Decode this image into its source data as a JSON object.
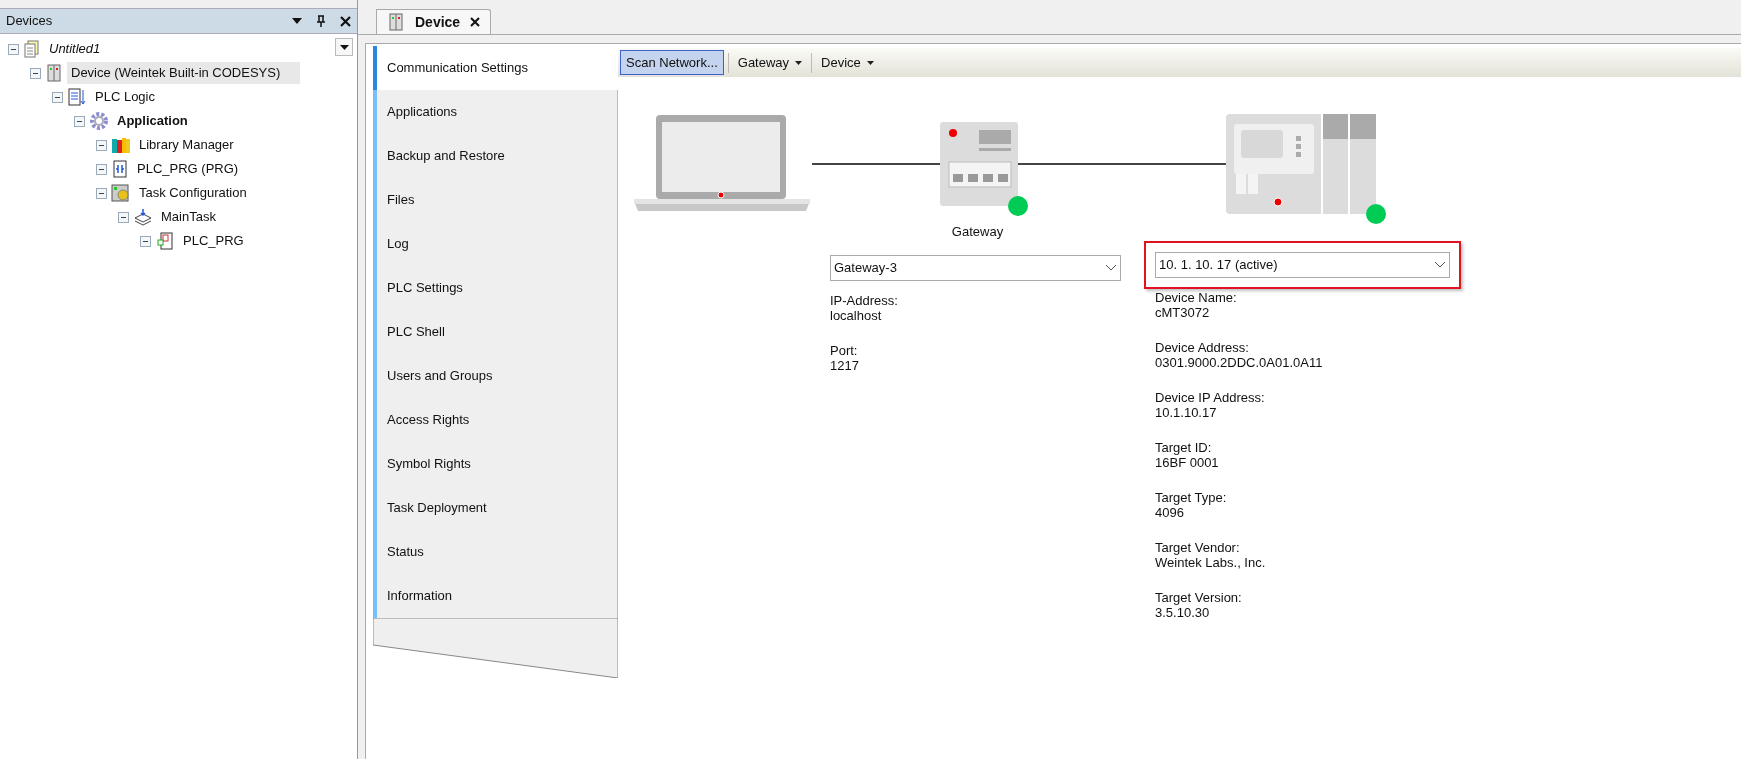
{
  "devices_panel": {
    "title": "Devices",
    "tree": [
      {
        "label": "Untitled1",
        "kind": "project",
        "selected": false,
        "active": false,
        "children": [
          {
            "label": "Device (Weintek Built-in CODESYS)",
            "kind": "device",
            "selected": true,
            "active": false,
            "children": [
              {
                "label": "PLC Logic",
                "kind": "plc-logic",
                "selected": false,
                "active": false,
                "children": [
                  {
                    "label": "Application",
                    "kind": "application",
                    "selected": false,
                    "active": true,
                    "children": [
                      {
                        "label": "Library Manager",
                        "kind": "library",
                        "selected": false,
                        "active": false
                      },
                      {
                        "label": "PLC_PRG (PRG)",
                        "kind": "pou",
                        "selected": false,
                        "active": false
                      },
                      {
                        "label": "Task Configuration",
                        "kind": "task-config",
                        "selected": false,
                        "active": false,
                        "children": [
                          {
                            "label": "MainTask",
                            "kind": "task",
                            "selected": false,
                            "active": false,
                            "children": [
                              {
                                "label": "PLC_PRG",
                                "kind": "program-call",
                                "selected": false,
                                "active": false
                              }
                            ]
                          }
                        ]
                      }
                    ]
                  }
                ]
              }
            ]
          }
        ]
      }
    ]
  },
  "editor_tab": {
    "label": "Device",
    "selected": true
  },
  "side_tabs": [
    {
      "label": "Communication Settings",
      "selected": true
    },
    {
      "label": "Applications",
      "selected": false
    },
    {
      "label": "Backup and Restore",
      "selected": false
    },
    {
      "label": "Files",
      "selected": false
    },
    {
      "label": "Log",
      "selected": false
    },
    {
      "label": "PLC Settings",
      "selected": false
    },
    {
      "label": "PLC Shell",
      "selected": false
    },
    {
      "label": "Users and Groups",
      "selected": false
    },
    {
      "label": "Access Rights",
      "selected": false
    },
    {
      "label": "Symbol Rights",
      "selected": false
    },
    {
      "label": "Task Deployment",
      "selected": false
    },
    {
      "label": "Status",
      "selected": false
    },
    {
      "label": "Information",
      "selected": false
    }
  ],
  "toolbar": [
    {
      "label": "Scan Network...",
      "kind": "button",
      "highlighted": true
    },
    {
      "label": "Gateway",
      "kind": "dropdown",
      "highlighted": false
    },
    {
      "label": "Device",
      "kind": "dropdown",
      "highlighted": false
    }
  ],
  "gateway": {
    "label": "Gateway",
    "online": true,
    "selector": {
      "value": "Gateway-3",
      "highlighted": false
    },
    "details": [
      {
        "label": "IP-Address:",
        "value": "localhost"
      },
      {
        "label": "Port:",
        "value": "1217"
      }
    ]
  },
  "device": {
    "online": true,
    "selector": {
      "value": "10. 1. 10. 17 (active)",
      "highlighted": true
    },
    "details": [
      {
        "label": "Device Name:",
        "value": "cMT3072"
      },
      {
        "label": "Device Address:",
        "value": "0301.9000.2DDC.0A01.0A11"
      },
      {
        "label": "Device IP Address:",
        "value": "10.1.10.17"
      },
      {
        "label": "Target ID:",
        "value": "16BF  0001"
      },
      {
        "label": "Target Type:",
        "value": "4096"
      },
      {
        "label": "Target Vendor:",
        "value": "Weintek Labs., Inc."
      },
      {
        "label": "Target Version:",
        "value": "3.5.10.30"
      }
    ]
  }
}
